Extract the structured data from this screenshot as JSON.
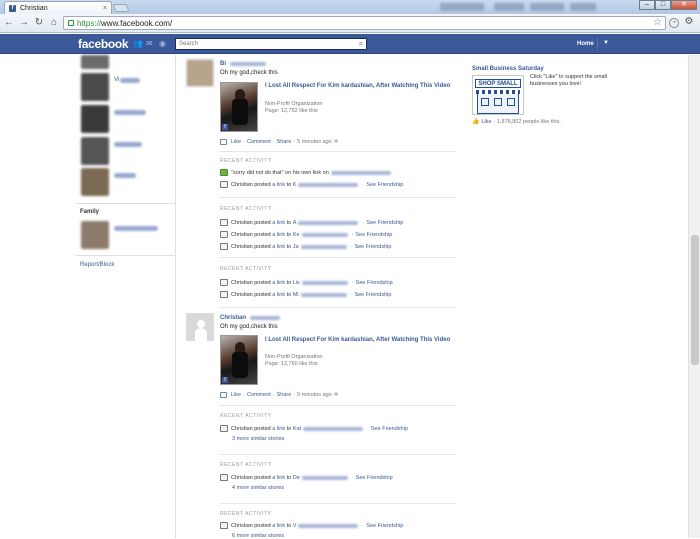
{
  "browser": {
    "tab_title": "Christian",
    "tab_close": "×",
    "url_scheme": "https://",
    "url_rest": "www.facebook.com/",
    "win_min": "–",
    "win_max": "□",
    "win_close": "✕"
  },
  "fb_bar": {
    "logo": "facebook",
    "search_placeholder": "Search",
    "home_label": "Home"
  },
  "left": {
    "friend_labels": [
      "Vi",
      "",
      "",
      "",
      ""
    ],
    "family_label": "Family",
    "report_label": "Report/Block"
  },
  "posts": [
    {
      "author": "Bi",
      "text": "Oh my god,check this",
      "link_title": "I Lost All Respect For Kim kardashian, After Watching This Video",
      "link_org": "Non-Profit Organization",
      "link_page": "Page: 12,752 like this",
      "actions": {
        "like": "Like",
        "comment": "Comment",
        "share": "Share",
        "time": "5 minutes ago"
      }
    },
    {
      "author": "Christian",
      "text": "Oh my god,check this",
      "link_title": "I Lost All Respect For Kim kardashian, After Watching This Video",
      "link_org": "Non-Profit Organization",
      "link_page": "Page: 12,760 like this",
      "actions": {
        "like": "Like",
        "comment": "Comment",
        "share": "Share",
        "time": "5 minutes ago"
      }
    }
  ],
  "recent_activity": {
    "header": "RECENT ACTIVITY",
    "comment_prefix": "\"sorry did not do that\" on his own link on",
    "posted": "Christian posted",
    "a_link": "a link",
    "to": "to",
    "see_friendship": "See Friendship",
    "to_names": [
      "K",
      "A",
      "Ke",
      "Ja",
      "Lis",
      "Mi",
      "Kat",
      "De",
      "V"
    ],
    "more_3": "3 more similar stories",
    "more_4": "4 more similar stories",
    "more_6": "6 more similar stories"
  },
  "ad": {
    "title": "Small Business Saturday",
    "img_label": "SHOP SMALL",
    "text": "Click \"Like\" to support the small businesses you love!",
    "like": "Like",
    "count": "· 1,878,802 people like this."
  }
}
